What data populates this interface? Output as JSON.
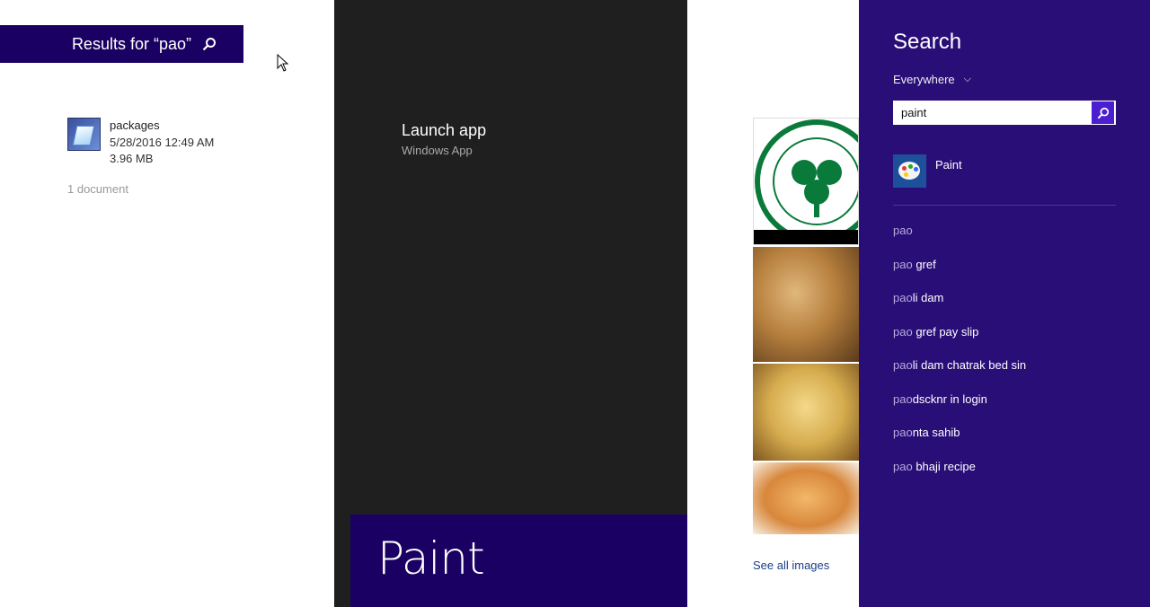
{
  "results": {
    "header": "Results for “pao”",
    "doc": {
      "name": "packages",
      "date": "5/28/2016 12:49 AM",
      "size": "3.96 MB"
    },
    "count": "1 document"
  },
  "preview": {
    "launch_title": "Launch app",
    "launch_sub": "Windows App",
    "banner": "Paint"
  },
  "images": {
    "see_all": "See all images"
  },
  "search": {
    "title": "Search",
    "scope": "Everywhere",
    "query": "paint",
    "app": {
      "name": "Paint"
    },
    "suggestions": [
      {
        "prefix": "pao",
        "rest": ""
      },
      {
        "prefix": "pao",
        "rest": " gref"
      },
      {
        "prefix": "pao",
        "rest": "li dam"
      },
      {
        "prefix": "pao",
        "rest": " gref pay slip"
      },
      {
        "prefix": "pao",
        "rest": "li dam chatrak bed sin"
      },
      {
        "prefix": "pao",
        "rest": "dscknr in login"
      },
      {
        "prefix": "pao",
        "rest": "nta sahib"
      },
      {
        "prefix": "pao",
        "rest": " bhaji recipe"
      }
    ]
  },
  "colors": {
    "accent": "#1a0062",
    "pane": "#2a0e78",
    "preview_bg": "#1f1f1f"
  }
}
